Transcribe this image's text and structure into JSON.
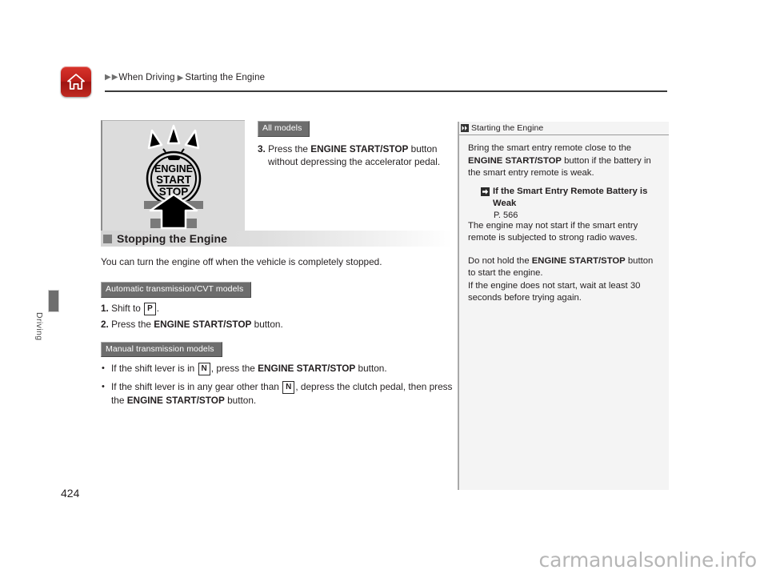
{
  "header": {
    "home_icon": "home-icon",
    "breadcrumb": {
      "arrow": "▶",
      "level1": "When Driving",
      "level2": "Starting the Engine"
    }
  },
  "sidebar": {
    "chapter_tab_label": "Driving",
    "page_number": "424"
  },
  "illustration": {
    "name": "engine-start-stop-button-illustration",
    "button_line1": "ENGINE",
    "button_line2": "START",
    "button_line3": "STOP"
  },
  "main": {
    "all_models_badge": "All models",
    "step3": {
      "number": "3.",
      "text_a": "Press the ",
      "bold": "ENGINE START/STOP",
      "text_b": " button",
      "line2": "without depressing the accelerator pedal."
    },
    "section": {
      "title": "Stopping the Engine",
      "intro": "You can turn the engine off when the vehicle is completely stopped."
    },
    "at_badge": "Automatic transmission/CVT models",
    "at_steps": [
      {
        "number": "1.",
        "text_a": "Shift to ",
        "gear": "P",
        "text_b": "."
      },
      {
        "number": "2.",
        "text_a": "Press the ",
        "bold": "ENGINE START/STOP",
        "text_b": " button."
      }
    ],
    "mt_badge": "Manual transmission models",
    "mt_bullets": [
      {
        "text_a": "If the shift lever is in ",
        "gear": "N",
        "text_b": ", press the ",
        "bold": "ENGINE START/STOP",
        "text_c": " button."
      },
      {
        "text_a": "If the shift lever is in any gear other than ",
        "gear": "N",
        "text_b": ", depress the clutch pedal, then press",
        "line2_a": "the ",
        "line2_bold": "ENGINE START/STOP",
        "line2_b": " button."
      }
    ]
  },
  "info_panel": {
    "heading": "Starting the Engine",
    "para1": {
      "a": "Bring the smart entry remote close to the ",
      "bold": "ENGINE START/STOP",
      "b": " button if the battery in the smart entry remote is weak."
    },
    "xref": {
      "title": "If the Smart Entry Remote Battery is Weak",
      "page": "P. 566"
    },
    "para2": "The engine may not start if the smart entry remote is subjected to strong radio waves.",
    "para3": {
      "a": "Do not hold the ",
      "bold": "ENGINE START/STOP",
      "b": " button to start the engine.",
      "line2": "If the engine does not start, wait at least 30 seconds before trying again."
    }
  },
  "watermark": "carmanualsonline.info",
  "colors": {
    "home_red": "#bd1f1a",
    "badge_gray": "#6d6d6d",
    "panel_bg": "#f4f4f4",
    "rule_dark": "#3b3b3b"
  }
}
